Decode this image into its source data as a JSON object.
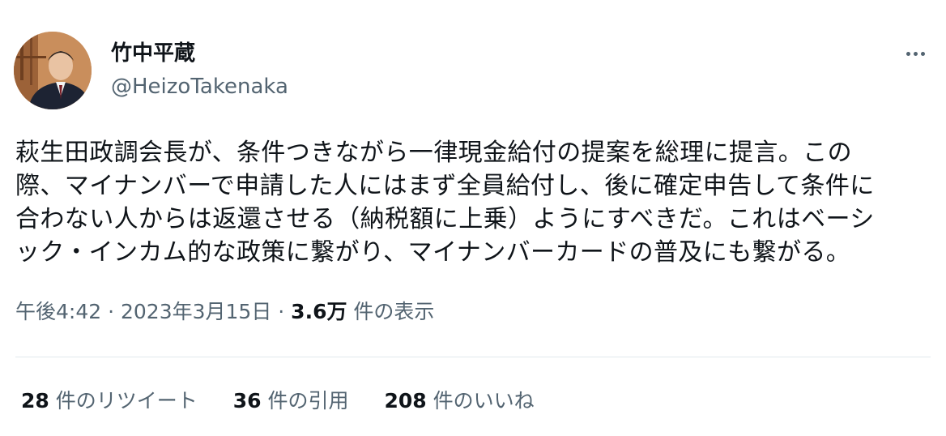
{
  "author": {
    "display_name": "竹中平蔵",
    "handle": "@HeizoTakenaka"
  },
  "more_icon": "more-horizontal-icon",
  "tweet": {
    "lines": [
      "萩生田政調会長が、条件つきながら一律現金給付の提案を総理に提言。この",
      "際、マイナンバーで申請した人にはまず全員給付し、後に確定申告して条件に",
      "合わない人からは返還させる（納税額に上乗）ようにすべきだ。これはベーシ",
      "ック・インカム的な政策に繋がり、マイナンバーカードの普及にも繋がる。"
    ]
  },
  "meta": {
    "time": "午後4:42",
    "separator": " · ",
    "date": "2023年3月15日",
    "views_count": "3.6万",
    "views_label": " 件の表示"
  },
  "stats": {
    "retweets": {
      "count": "28",
      "label": " 件のリツイート"
    },
    "quotes": {
      "count": "36",
      "label": " 件の引用"
    },
    "likes": {
      "count": "208",
      "label": " 件のいいね"
    }
  },
  "colors": {
    "text_primary": "#0f1419",
    "text_secondary": "#536471",
    "divider": "#e1e8ed",
    "background": "#ffffff"
  }
}
